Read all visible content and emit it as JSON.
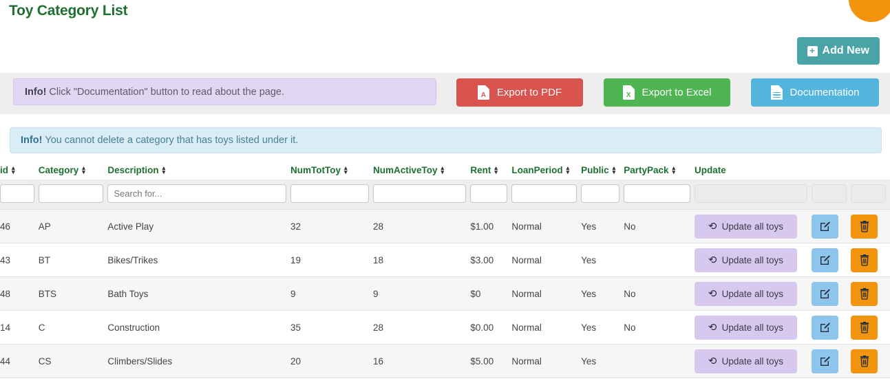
{
  "page": {
    "title": "Toy Category List"
  },
  "toolbar": {
    "add_new_label": "Add New",
    "add_icon": "plus-square-icon",
    "export_pdf_label": "Export to PDF",
    "export_pdf_icon": "pdf-file-icon",
    "export_excel_label": "Export to Excel",
    "export_excel_icon": "excel-file-icon",
    "documentation_label": "Documentation",
    "documentation_icon": "doc-file-icon"
  },
  "alerts": {
    "purple": {
      "strong": "Info!",
      "text": "Click \"Documentation\" button to read about the page."
    },
    "blue": {
      "strong": "Info!",
      "text": "You cannot delete a category that has toys listed under it."
    }
  },
  "table": {
    "columns": [
      {
        "label": "id",
        "sortable": true
      },
      {
        "label": "Category",
        "sortable": true
      },
      {
        "label": "Description",
        "sortable": true
      },
      {
        "label": "NumTotToy",
        "sortable": true
      },
      {
        "label": "NumActiveToy",
        "sortable": true
      },
      {
        "label": "Rent",
        "sortable": true
      },
      {
        "label": "LoanPeriod",
        "sortable": true
      },
      {
        "label": "Public",
        "sortable": true
      },
      {
        "label": "PartyPack",
        "sortable": true
      },
      {
        "label": "Update",
        "sortable": false
      }
    ],
    "filters": [
      {
        "name": "id",
        "value": "",
        "placeholder": "",
        "disabled": false
      },
      {
        "name": "category",
        "value": "",
        "placeholder": "",
        "disabled": false
      },
      {
        "name": "description",
        "value": "",
        "placeholder": "Search for...",
        "disabled": false
      },
      {
        "name": "numtottoy",
        "value": "",
        "placeholder": "",
        "disabled": false
      },
      {
        "name": "numactivetoy",
        "value": "",
        "placeholder": "",
        "disabled": false
      },
      {
        "name": "rent",
        "value": "",
        "placeholder": "",
        "disabled": false
      },
      {
        "name": "loanperiod",
        "value": "",
        "placeholder": "",
        "disabled": false
      },
      {
        "name": "public",
        "value": "",
        "placeholder": "",
        "disabled": false
      },
      {
        "name": "partypack",
        "value": "",
        "placeholder": "",
        "disabled": false
      },
      {
        "name": "update",
        "value": "",
        "placeholder": "",
        "disabled": true
      },
      {
        "name": "edit",
        "value": "",
        "placeholder": "",
        "disabled": true
      },
      {
        "name": "delete",
        "value": "",
        "placeholder": "",
        "disabled": true
      }
    ],
    "rows": [
      {
        "id": "46",
        "category": "AP",
        "description": "Active Play",
        "numtottoy": "32",
        "numactivetoy": "28",
        "rent": "$1.00",
        "loanperiod": "Normal",
        "public": "Yes",
        "partypack": "No"
      },
      {
        "id": "43",
        "category": "BT",
        "description": "Bikes/Trikes",
        "numtottoy": "19",
        "numactivetoy": "18",
        "rent": "$3.00",
        "loanperiod": "Normal",
        "public": "Yes",
        "partypack": ""
      },
      {
        "id": "48",
        "category": "BTS",
        "description": "Bath Toys",
        "numtottoy": "9",
        "numactivetoy": "9",
        "rent": "$0",
        "loanperiod": "Normal",
        "public": "Yes",
        "partypack": "No"
      },
      {
        "id": "14",
        "category": "C",
        "description": "Construction",
        "numtottoy": "35",
        "numactivetoy": "28",
        "rent": "$0.00",
        "loanperiod": "Normal",
        "public": "Yes",
        "partypack": "No"
      },
      {
        "id": "44",
        "category": "CS",
        "description": "Climbers/Slides",
        "numtottoy": "20",
        "numactivetoy": "16",
        "rent": "$5.00",
        "loanperiod": "Normal",
        "public": "Yes",
        "partypack": ""
      }
    ],
    "row_actions": {
      "update_label": "Update all toys",
      "update_icon": "refresh-icon",
      "edit_icon": "edit-pencil-icon",
      "delete_icon": "trash-icon"
    }
  },
  "colors": {
    "title_green": "#1d7030",
    "add_new_teal": "#4aa4a7",
    "pdf_red": "#d9534f",
    "excel_green": "#4fb552",
    "doc_blue": "#53b5dd",
    "alert_purple": "#e2d7f2",
    "alert_blue": "#d9edf7",
    "update_lilac": "#d7c8f0",
    "edit_blue": "#8ec5ec",
    "delete_orange": "#f3940e"
  }
}
